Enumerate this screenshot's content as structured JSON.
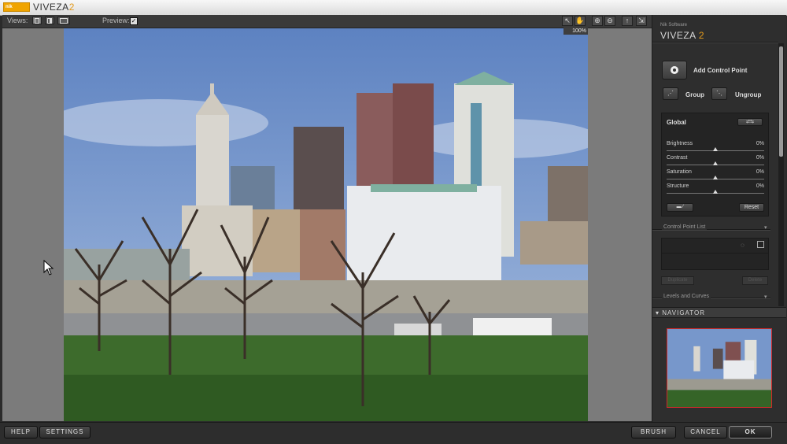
{
  "window": {
    "title_prefix": "VIVEZA",
    "title_suffix": "2",
    "logo_text": "nik"
  },
  "toolbar": {
    "views_label": "Views:",
    "preview_label": "Preview:",
    "preview_checked": "✓",
    "zoom_level": "100%"
  },
  "panel": {
    "brand_small": "Nik Software",
    "brand_name": "VIVEZA",
    "brand_version": "2",
    "add_control_point": "Add Control Point",
    "group_label": "Group",
    "ungroup_label": "Ungroup",
    "global_title": "Global",
    "sliders": [
      {
        "label": "Brightness",
        "value": "0%"
      },
      {
        "label": "Contrast",
        "value": "0%"
      },
      {
        "label": "Saturation",
        "value": "0%"
      },
      {
        "label": "Structure",
        "value": "0%"
      }
    ],
    "reset_label": "Reset",
    "control_point_list_header": "Control Point List",
    "duplicate_label": "Duplicate",
    "delete_label": "Delete",
    "levels_curves_header": "Levels and Curves",
    "navigator_header": "NAVIGATOR"
  },
  "bottom": {
    "help": "HELP",
    "settings": "SETTINGS",
    "brush": "BRUSH",
    "cancel": "CANCEL",
    "ok": "OK"
  },
  "colors": {
    "accent": "#e39a1c",
    "navigator_frame": "#d12a2a",
    "panel_bg": "#2e2e2e"
  },
  "icons": [
    "view-single-icon",
    "view-split-icon",
    "view-side-by-side-icon",
    "pointer-icon",
    "hand-icon",
    "zoom-in-icon",
    "zoom-out-icon",
    "pin-icon",
    "fit-icon"
  ]
}
